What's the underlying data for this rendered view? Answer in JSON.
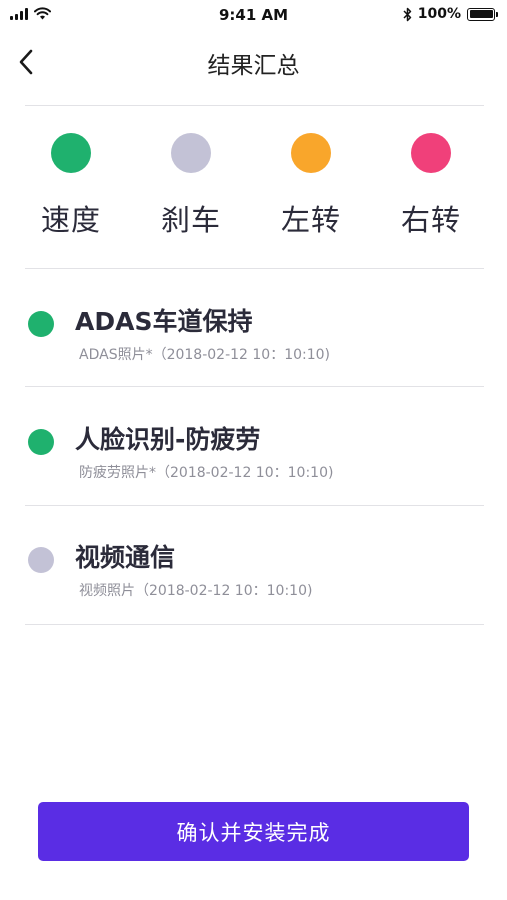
{
  "status_bar": {
    "time": "9:41 AM",
    "battery_text": "100%",
    "icons": [
      "signal-icon",
      "wifi-icon",
      "bluetooth-icon",
      "battery-icon"
    ]
  },
  "header": {
    "back_icon": "chevron-left-icon",
    "title": "结果汇总"
  },
  "legend": [
    {
      "label": "速度",
      "color": "#1fb16e"
    },
    {
      "label": "刹车",
      "color": "#c3c2d6"
    },
    {
      "label": "左转",
      "color": "#f9a62b"
    },
    {
      "label": "右转",
      "color": "#f0407a"
    }
  ],
  "results": [
    {
      "title": "ADAS车道保持",
      "subtitle": "ADAS照片*（2018-02-12 10：10:10)",
      "color": "#1fb16e"
    },
    {
      "title": "人脸识别-防疲劳",
      "subtitle": "防疲劳照片*（2018-02-12 10：10:10)",
      "color": "#1fb16e"
    },
    {
      "title": "视频通信",
      "subtitle": "视频照片（2018-02-12 10：10:10)",
      "color": "#c3c2d6"
    }
  ],
  "confirm_button": {
    "label": "确认并安装完成",
    "color": "#5a2de4"
  }
}
